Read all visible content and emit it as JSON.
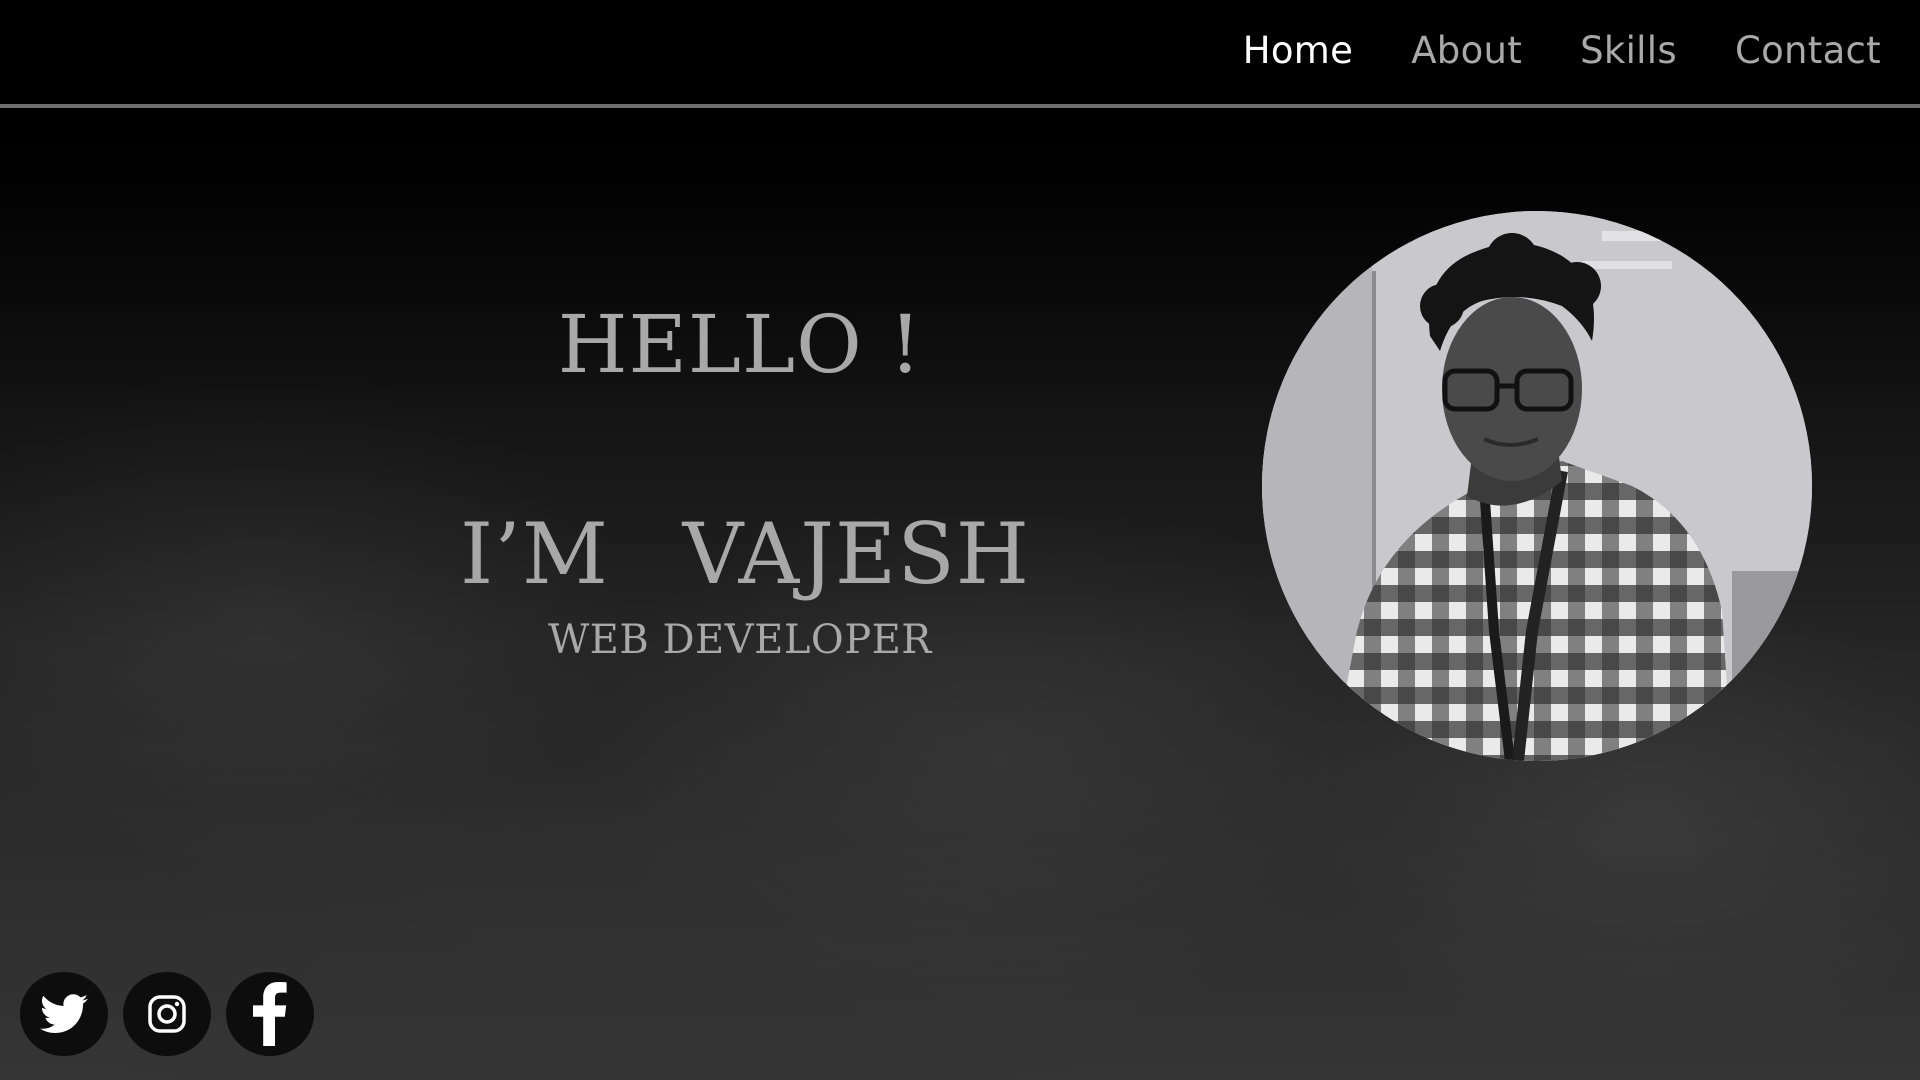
{
  "nav": {
    "items": [
      {
        "label": "Home",
        "active": true
      },
      {
        "label": "About",
        "active": false
      },
      {
        "label": "Skills",
        "active": false
      },
      {
        "label": "Contact",
        "active": false
      }
    ]
  },
  "hero": {
    "greeting": "HELLO !",
    "name_line": "I’M VAJESH",
    "role": "WEB DEVELOPER"
  },
  "social": [
    {
      "icon": "twitter-icon"
    },
    {
      "icon": "instagram-icon"
    },
    {
      "icon": "facebook-icon"
    }
  ],
  "colors": {
    "nav_bg": "#000000",
    "nav_active": "#ffffff",
    "nav_inactive": "#a9a9a9",
    "hero_text": "#a8a8a8",
    "nav_border": "#6e6e6e"
  }
}
